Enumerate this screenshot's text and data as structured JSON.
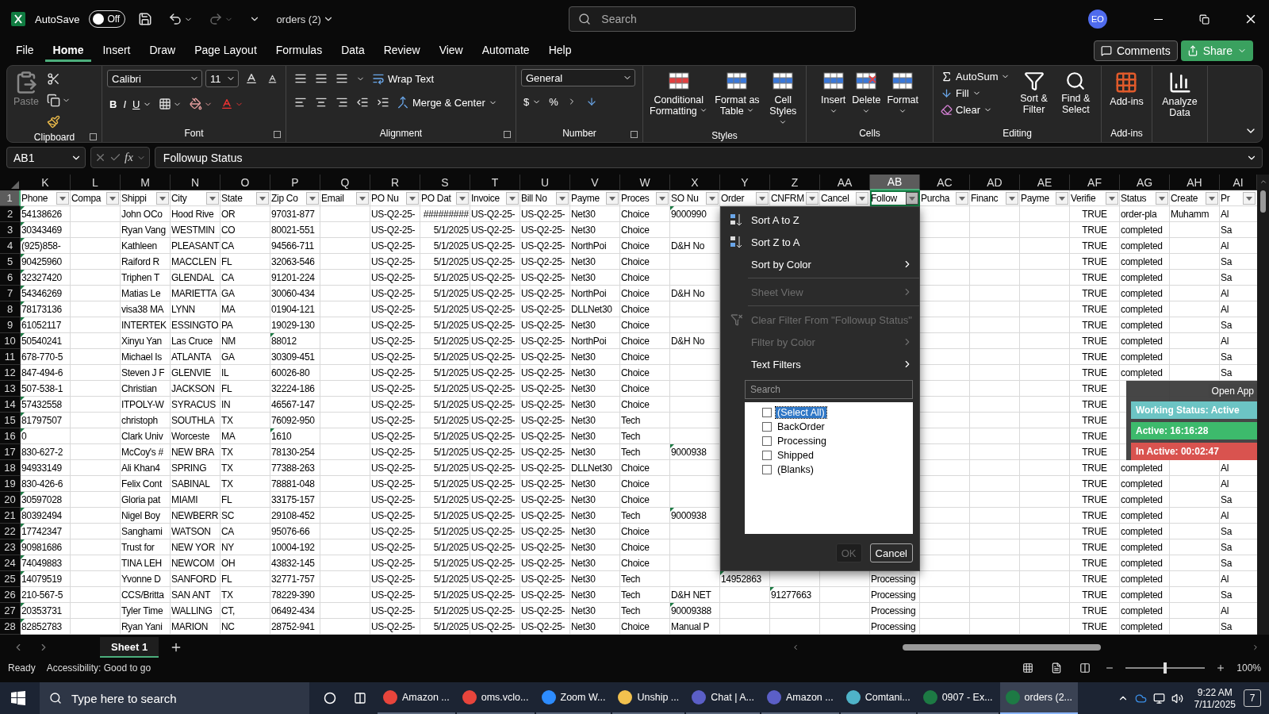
{
  "title_bar": {
    "autosave_label": "AutoSave",
    "autosave": {
      "on": false,
      "label": "Off"
    },
    "file_name": "orders (2)",
    "search_placeholder": "Search",
    "avatar": "EO"
  },
  "menu_tabs": [
    {
      "label": "File",
      "selected": false
    },
    {
      "label": "Home",
      "selected": true
    },
    {
      "label": "Insert",
      "selected": false
    },
    {
      "label": "Draw",
      "selected": false
    },
    {
      "label": "Page Layout",
      "selected": false
    },
    {
      "label": "Formulas",
      "selected": false
    },
    {
      "label": "Data",
      "selected": false
    },
    {
      "label": "Review",
      "selected": false
    },
    {
      "label": "View",
      "selected": false
    },
    {
      "label": "Automate",
      "selected": false
    },
    {
      "label": "Help",
      "selected": false
    }
  ],
  "comments": "Comments",
  "share": "Share",
  "ribbon": {
    "clipboard": {
      "paste": "Paste",
      "label": "Clipboard"
    },
    "font": {
      "family": "Calibri",
      "size": "11",
      "bold": "B",
      "italic": "I",
      "underline": "U",
      "label": "Font"
    },
    "alignment": {
      "wrap": "Wrap Text",
      "merge": "Merge & Center",
      "label": "Alignment"
    },
    "number": {
      "format": "General",
      "currency": "$",
      "percent": "%",
      "label": "Number"
    },
    "styles": {
      "buttons": [
        "Conditional Formatting",
        "Format as Table",
        "Cell Styles"
      ],
      "label": "Styles"
    },
    "cells": {
      "buttons": [
        "Insert",
        "Delete",
        "Format"
      ],
      "label": "Cells"
    },
    "editing": {
      "autosum": "AutoSum",
      "fill": "Fill",
      "clear": "Clear",
      "sort": "Sort & Filter",
      "find": "Find & Select",
      "label": "Editing"
    },
    "addins": {
      "button": "Add-ins",
      "label": "Add-ins"
    },
    "analyze": {
      "button": "Analyze Data"
    }
  },
  "formula_bar": {
    "name_box": "AB1",
    "fx": "fx",
    "formula": "Followup Status"
  },
  "sheet": {
    "header_row": {
      "num": "1",
      "selected": true
    },
    "columns": [
      {
        "letter": "K",
        "header": "Phone",
        "selected": false,
        "filter_open": false,
        "kind": "text"
      },
      {
        "letter": "L",
        "header": "Compa",
        "selected": false,
        "filter_open": false,
        "kind": "text"
      },
      {
        "letter": "M",
        "header": "Shippi",
        "selected": false,
        "filter_open": false,
        "kind": "text"
      },
      {
        "letter": "N",
        "header": "City",
        "selected": false,
        "filter_open": false,
        "kind": "text"
      },
      {
        "letter": "O",
        "header": "State",
        "selected": false,
        "filter_open": false,
        "kind": "text"
      },
      {
        "letter": "P",
        "header": "Zip Co",
        "selected": false,
        "filter_open": false,
        "kind": "text"
      },
      {
        "letter": "Q",
        "header": "Email",
        "selected": false,
        "filter_open": false,
        "kind": "text"
      },
      {
        "letter": "R",
        "header": "PO Nu",
        "selected": false,
        "filter_open": false,
        "kind": "text"
      },
      {
        "letter": "S",
        "header": "PO Dat",
        "selected": false,
        "filter_open": false,
        "kind": "date"
      },
      {
        "letter": "T",
        "header": "Invoice",
        "selected": false,
        "filter_open": false,
        "kind": "text"
      },
      {
        "letter": "U",
        "header": "Bill No",
        "selected": false,
        "filter_open": false,
        "kind": "text"
      },
      {
        "letter": "V",
        "header": "Payme",
        "selected": false,
        "filter_open": false,
        "kind": "text"
      },
      {
        "letter": "W",
        "header": "Proces",
        "selected": false,
        "filter_open": false,
        "kind": "text"
      },
      {
        "letter": "X",
        "header": "SO Nu",
        "selected": false,
        "filter_open": false,
        "kind": "text"
      },
      {
        "letter": "Y",
        "header": "Order",
        "selected": false,
        "filter_open": false,
        "kind": "text"
      },
      {
        "letter": "Z",
        "header": "CNFRM",
        "selected": false,
        "filter_open": false,
        "kind": "text"
      },
      {
        "letter": "AA",
        "header": "Cancel",
        "selected": false,
        "filter_open": false,
        "kind": "text"
      },
      {
        "letter": "AB",
        "header": "Follow",
        "selected": true,
        "filter_open": true,
        "kind": "text"
      },
      {
        "letter": "AC",
        "header": "Purcha",
        "selected": false,
        "filter_open": false,
        "kind": "text"
      },
      {
        "letter": "AD",
        "header": "Financ",
        "selected": false,
        "filter_open": false,
        "kind": "text"
      },
      {
        "letter": "AE",
        "header": "Payme",
        "selected": false,
        "filter_open": false,
        "kind": "text"
      },
      {
        "letter": "AF",
        "header": "Verifie",
        "selected": false,
        "filter_open": false,
        "kind": "boolean"
      },
      {
        "letter": "AG",
        "header": "Status",
        "selected": false,
        "filter_open": false,
        "kind": "text"
      },
      {
        "letter": "AH",
        "header": "Create",
        "selected": false,
        "filter_open": false,
        "kind": "text"
      },
      {
        "letter": "AI",
        "header": "Pr",
        "selected": false,
        "filter_open": false,
        "kind": "text"
      }
    ],
    "rows": [
      {
        "num": "2",
        "cells": [
          {
            "text": "54138626",
            "flagged": true
          },
          null,
          "John OCo",
          "Hood Rive",
          "OR",
          "97031-877",
          null,
          "US-Q2-25-",
          "#########",
          "US-Q2-25-",
          "US-Q2-25-",
          "Net30",
          "Choice",
          {
            "text": "9000990",
            "flagged": true
          },
          null,
          null,
          null,
          null,
          null,
          null,
          null,
          "TRUE",
          "order-pla",
          "Muhamm",
          "Al"
        ]
      },
      {
        "num": "3",
        "cells": [
          {
            "text": "30343469",
            "flagged": true
          },
          null,
          "Ryan Vang",
          "WESTMIN",
          "CO",
          "80021-551",
          null,
          "US-Q2-25-",
          "5/1/2025",
          "US-Q2-25-",
          "US-Q2-25-",
          "Net30",
          "Choice",
          null,
          null,
          null,
          null,
          null,
          null,
          null,
          null,
          "TRUE",
          "completed",
          null,
          "Sa"
        ]
      },
      {
        "num": "4",
        "cells": [
          {
            "text": "(925)858-",
            "flagged": true
          },
          null,
          "Kathleen",
          "PLEASANT",
          "CA",
          "94566-711",
          null,
          "US-Q2-25-",
          "5/1/2025",
          "US-Q2-25-",
          "US-Q2-25-",
          "NorthPoi",
          "Choice",
          "D&H No",
          null,
          null,
          null,
          null,
          null,
          null,
          null,
          "TRUE",
          "completed",
          null,
          "Al"
        ]
      },
      {
        "num": "5",
        "cells": [
          {
            "text": "90425960",
            "flagged": true
          },
          null,
          "Raiford R",
          "MACCLEN",
          "FL",
          "32063-546",
          null,
          "US-Q2-25-",
          "5/1/2025",
          "US-Q2-25-",
          "US-Q2-25-",
          "Net30",
          "Choice",
          null,
          null,
          null,
          null,
          null,
          null,
          null,
          null,
          "TRUE",
          "completed",
          null,
          "Sa"
        ]
      },
      {
        "num": "6",
        "cells": [
          {
            "text": "32327420",
            "flagged": true
          },
          null,
          "Triphen T",
          "GLENDAL",
          "CA",
          "91201-224",
          null,
          "US-Q2-25-",
          "5/1/2025",
          "US-Q2-25-",
          "US-Q2-25-",
          "Net30",
          "Choice",
          null,
          null,
          null,
          null,
          null,
          null,
          null,
          null,
          "TRUE",
          "completed",
          null,
          "Sa"
        ]
      },
      {
        "num": "7",
        "cells": [
          {
            "text": "54346269",
            "flagged": true
          },
          null,
          "Matias Le",
          "MARIETTA",
          "GA",
          "30060-434",
          null,
          "US-Q2-25-",
          "5/1/2025",
          "US-Q2-25-",
          "US-Q2-25-",
          "NorthPoi",
          "Choice",
          "D&H No",
          null,
          null,
          null,
          null,
          null,
          null,
          null,
          "TRUE",
          "completed",
          null,
          "Al"
        ]
      },
      {
        "num": "8",
        "cells": [
          {
            "text": "78173136",
            "flagged": true
          },
          null,
          "visa38 MA",
          "LYNN",
          "MA",
          "01904-121",
          null,
          "US-Q2-25-",
          "5/1/2025",
          "US-Q2-25-",
          "US-Q2-25-",
          "DLLNet30",
          "Choice",
          null,
          null,
          null,
          null,
          null,
          null,
          null,
          null,
          "TRUE",
          "completed",
          null,
          "Al"
        ]
      },
      {
        "num": "9",
        "cells": [
          {
            "text": "61052117",
            "flagged": true
          },
          null,
          "INTERTEK",
          "ESSINGTO",
          "PA",
          "19029-130",
          null,
          "US-Q2-25-",
          "5/1/2025",
          "US-Q2-25-",
          "US-Q2-25-",
          "Net30",
          "Choice",
          null,
          null,
          null,
          null,
          null,
          null,
          null,
          null,
          "TRUE",
          "completed",
          null,
          "Sa"
        ]
      },
      {
        "num": "10",
        "cells": [
          {
            "text": "50540241",
            "flagged": true
          },
          null,
          "Xinyu Yan",
          "Las Cruce",
          "NM",
          {
            "text": "88012",
            "flagged": true
          },
          null,
          "US-Q2-25-",
          "5/1/2025",
          "US-Q2-25-",
          "US-Q2-25-",
          "NorthPoi",
          "Choice",
          "D&H No",
          null,
          null,
          null,
          null,
          null,
          null,
          null,
          "TRUE",
          "completed",
          null,
          "Al"
        ]
      },
      {
        "num": "11",
        "cells": [
          "678-770-5",
          null,
          "Michael Is",
          "ATLANTA",
          "GA",
          "30309-451",
          null,
          "US-Q2-25-",
          "5/1/2025",
          "US-Q2-25-",
          "US-Q2-25-",
          "Net30",
          "Choice",
          null,
          null,
          null,
          null,
          null,
          null,
          null,
          null,
          "TRUE",
          "completed",
          null,
          "Sa"
        ]
      },
      {
        "num": "12",
        "cells": [
          "847-494-6",
          null,
          "Steven J F",
          "GLENVIE",
          "IL",
          "60026-80",
          null,
          "US-Q2-25-",
          "5/1/2025",
          "US-Q2-25-",
          "US-Q2-25-",
          "Net30",
          "Choice",
          null,
          null,
          null,
          null,
          null,
          null,
          null,
          null,
          "TRUE",
          "completed",
          null,
          "Sa"
        ]
      },
      {
        "num": "13",
        "cells": [
          "507-538-1",
          null,
          "Christian",
          "JACKSON",
          "FL",
          "32224-186",
          null,
          "US-Q2-25-",
          "5/1/2025",
          "US-Q2-25-",
          "US-Q2-25-",
          "Net30",
          "Choice",
          null,
          null,
          null,
          null,
          null,
          null,
          null,
          null,
          "TRUE",
          null,
          null,
          null
        ]
      },
      {
        "num": "14",
        "cells": [
          {
            "text": "57432558",
            "flagged": true
          },
          null,
          "ITPOLY-W",
          "SYRACUS",
          "IN",
          "46567-147",
          null,
          "US-Q2-25-",
          "5/1/2025",
          "US-Q2-25-",
          "US-Q2-25-",
          "Net30",
          "Choice",
          null,
          null,
          null,
          null,
          null,
          null,
          null,
          null,
          "TRUE",
          null,
          null,
          null
        ]
      },
      {
        "num": "15",
        "cells": [
          {
            "text": "81797507",
            "flagged": true
          },
          null,
          "christoph",
          "SOUTHLA",
          "TX",
          "76092-950",
          null,
          "US-Q2-25-",
          "5/1/2025",
          "US-Q2-25-",
          "US-Q2-25-",
          "Net30",
          "Tech",
          null,
          null,
          null,
          null,
          null,
          null,
          null,
          null,
          "TRUE",
          null,
          null,
          null
        ]
      },
      {
        "num": "16",
        "cells": [
          {
            "text": "0",
            "flagged": true
          },
          null,
          "Clark Univ",
          "Worceste",
          "MA",
          {
            "text": "1610",
            "flagged": true
          },
          null,
          "US-Q2-25-",
          "5/1/2025",
          "US-Q2-25-",
          "US-Q2-25-",
          "Net30",
          "Tech",
          null,
          null,
          null,
          null,
          null,
          null,
          null,
          null,
          "TRUE",
          null,
          null,
          null
        ]
      },
      {
        "num": "17",
        "cells": [
          "830-627-2",
          null,
          "McCoy's #",
          "NEW BRA",
          "TX",
          "78130-254",
          null,
          "US-Q2-25-",
          "5/1/2025",
          "US-Q2-25-",
          "US-Q2-25-",
          "Net30",
          "Tech",
          {
            "text": "9000938",
            "flagged": true
          },
          null,
          null,
          null,
          null,
          null,
          null,
          null,
          "TRUE",
          null,
          null,
          null
        ]
      },
      {
        "num": "18",
        "cells": [
          "94933149",
          null,
          "Ali Khan4",
          "SPRING",
          "TX",
          "77388-263",
          null,
          "US-Q2-25-",
          "5/1/2025",
          "US-Q2-25-",
          "US-Q2-25-",
          "DLLNet30",
          "Choice",
          null,
          null,
          null,
          null,
          null,
          null,
          null,
          null,
          "TRUE",
          "completed",
          null,
          "Al"
        ]
      },
      {
        "num": "19",
        "cells": [
          "830-426-6",
          null,
          "Felix Cont",
          "SABINAL",
          "TX",
          "78881-048",
          null,
          "US-Q2-25-",
          "5/1/2025",
          "US-Q2-25-",
          "US-Q2-25-",
          "Net30",
          "Choice",
          null,
          null,
          null,
          null,
          null,
          null,
          null,
          null,
          "TRUE",
          "completed",
          null,
          "Al"
        ]
      },
      {
        "num": "20",
        "cells": [
          {
            "text": "30597028",
            "flagged": true
          },
          null,
          "Gloria pat",
          "MIAMI",
          "FL",
          "33175-157",
          null,
          "US-Q2-25-",
          "5/1/2025",
          "US-Q2-25-",
          "US-Q2-25-",
          "Net30",
          "Choice",
          null,
          null,
          null,
          null,
          null,
          null,
          null,
          null,
          "TRUE",
          "completed",
          null,
          "Sa"
        ]
      },
      {
        "num": "21",
        "cells": [
          {
            "text": "80392494",
            "flagged": true
          },
          null,
          "Nigel Boy",
          "NEWBERR",
          "SC",
          "29108-452",
          null,
          "US-Q2-25-",
          "5/1/2025",
          "US-Q2-25-",
          "US-Q2-25-",
          "Net30",
          "Tech",
          {
            "text": "9000938",
            "flagged": true
          },
          null,
          null,
          null,
          null,
          null,
          null,
          null,
          "TRUE",
          "completed",
          null,
          "Al"
        ]
      },
      {
        "num": "22",
        "cells": [
          {
            "text": "17742347",
            "flagged": true
          },
          null,
          "Sanghami",
          "WATSON",
          "CA",
          "95076-66",
          null,
          "US-Q2-25-",
          "5/1/2025",
          "US-Q2-25-",
          "US-Q2-25-",
          "Net30",
          "Choice",
          null,
          null,
          null,
          null,
          null,
          null,
          null,
          null,
          "TRUE",
          "completed",
          null,
          "Sa"
        ]
      },
      {
        "num": "23",
        "cells": [
          {
            "text": "90981686",
            "flagged": true
          },
          null,
          "Trust for",
          "NEW YOR",
          "NY",
          "10004-192",
          null,
          "US-Q2-25-",
          "5/1/2025",
          "US-Q2-25-",
          "US-Q2-25-",
          "Net30",
          "Choice",
          null,
          null,
          null,
          null,
          null,
          null,
          null,
          null,
          "TRUE",
          "completed",
          null,
          "Sa"
        ]
      },
      {
        "num": "24",
        "cells": [
          {
            "text": "74049883",
            "flagged": true
          },
          null,
          "TINA LEH",
          "NEWCOM",
          "OH",
          "43832-145",
          null,
          "US-Q2-25-",
          "5/1/2025",
          "US-Q2-25-",
          "US-Q2-25-",
          "Net30",
          "Choice",
          null,
          null,
          null,
          null,
          null,
          null,
          null,
          null,
          "TRUE",
          "completed",
          null,
          "Sa"
        ]
      },
      {
        "num": "25",
        "cells": [
          {
            "text": "14079519",
            "flagged": true
          },
          null,
          "Yvonne D",
          "SANFORD",
          "FL",
          "32771-757",
          null,
          "US-Q2-25-",
          "5/1/2025",
          "US-Q2-25-",
          "US-Q2-25-",
          "Net30",
          "Tech",
          null,
          {
            "text": "14952863",
            "flagged": true
          },
          null,
          null,
          "Processing",
          null,
          null,
          null,
          "TRUE",
          "completed",
          null,
          "Al"
        ]
      },
      {
        "num": "26",
        "cells": [
          "210-567-5",
          null,
          "CCS/Britta",
          "SAN ANT",
          "TX",
          "78229-390",
          null,
          "US-Q2-25-",
          "5/1/2025",
          "US-Q2-25-",
          "US-Q2-25-",
          "Net30",
          "Tech",
          "D&H NET",
          null,
          {
            "text": "91277663",
            "flagged": true
          },
          null,
          "Processing",
          null,
          null,
          null,
          "TRUE",
          "completed",
          null,
          "Sa"
        ]
      },
      {
        "num": "27",
        "cells": [
          {
            "text": "20353731",
            "flagged": true
          },
          null,
          "Tyler Time",
          "WALLING",
          "CT,",
          "06492-434",
          null,
          "US-Q2-25-",
          "5/1/2025",
          "US-Q2-25-",
          "US-Q2-25-",
          "Net30",
          "Tech",
          {
            "text": "90009388",
            "flagged": true
          },
          null,
          null,
          null,
          "Processing",
          null,
          null,
          null,
          "TRUE",
          "completed",
          null,
          "Al"
        ]
      },
      {
        "num": "28",
        "cells": [
          {
            "text": "82852783",
            "flagged": true
          },
          null,
          "Ryan Yani",
          "MARION",
          "NC",
          "28752-941",
          null,
          "US-Q2-25-",
          "5/1/2025",
          "US-Q2-25-",
          "US-Q2-25-",
          "Net30",
          "Choice",
          "Manual P",
          null,
          null,
          null,
          "Processing",
          null,
          null,
          null,
          "TRUE",
          "completed",
          null,
          "Sa"
        ]
      }
    ]
  },
  "filter_menu": {
    "items": [
      {
        "kind": "sort_asc",
        "label": "Sort A to Z",
        "disabled": false,
        "submenu": false
      },
      {
        "kind": "sort_desc",
        "label": "Sort Z to A",
        "disabled": false,
        "submenu": false
      },
      {
        "kind": "plain",
        "label": "Sort by Color",
        "disabled": false,
        "submenu": true
      },
      {
        "kind": "separator"
      },
      {
        "kind": "plain",
        "label": "Sheet View",
        "disabled": true,
        "submenu": true
      },
      {
        "kind": "separator"
      },
      {
        "kind": "clear_filter",
        "label": "Clear Filter From \"Followup Status\"",
        "disabled": true,
        "submenu": false
      },
      {
        "kind": "plain",
        "label": "Filter by Color",
        "disabled": true,
        "submenu": true
      },
      {
        "kind": "plain",
        "label": "Text Filters",
        "disabled": false,
        "submenu": true
      }
    ],
    "search_placeholder": "Search",
    "values": [
      {
        "label": "(Select All)",
        "checked": false,
        "selected": true
      },
      {
        "label": "BackOrder",
        "checked": false,
        "selected": false
      },
      {
        "label": "Processing",
        "checked": false,
        "selected": false
      },
      {
        "label": "Shipped",
        "checked": false,
        "selected": false
      },
      {
        "label": "(Blanks)",
        "checked": false,
        "selected": false
      }
    ],
    "ok": {
      "label": "OK",
      "disabled": true
    },
    "cancel": {
      "label": "Cancel",
      "disabled": false
    }
  },
  "timer_widget": {
    "open_app": "Open App",
    "bars": [
      {
        "text": "Working Status: Active",
        "color": "#6cc4c4"
      },
      {
        "text": "Active: 16:16:28",
        "color": "#3dba6c"
      },
      {
        "text": "In Active: 00:02:47",
        "color": "#d9534f"
      }
    ]
  },
  "sheet_tabs": [
    {
      "label": "Sheet 1",
      "selected": true
    }
  ],
  "status_bar": {
    "ready": "Ready",
    "accessibility": "Accessibility: Good to go",
    "zoom": {
      "level": 0.5,
      "label": "100%"
    }
  },
  "taskbar": {
    "search_placeholder": "Type here to search",
    "apps": [
      {
        "label": "Amazon ...",
        "color": "#e8453c",
        "selected": false
      },
      {
        "label": "oms.vclo...",
        "color": "#e8453c",
        "selected": false
      },
      {
        "label": "Zoom W...",
        "color": "#2d8cff",
        "selected": false
      },
      {
        "label": "Unship ...",
        "color": "#f2c14e",
        "selected": false
      },
      {
        "label": "Chat | A...",
        "color": "#5b5fc7",
        "selected": false
      },
      {
        "label": "Amazon ...",
        "color": "#5b5fc7",
        "selected": false
      },
      {
        "label": "Comtani...",
        "color": "#4fb3c8",
        "selected": false
      },
      {
        "label": "0907 - Ex...",
        "color": "#1d7a44",
        "selected": false
      },
      {
        "label": "orders (2...",
        "color": "#1d7a44",
        "selected": true
      }
    ],
    "time": "9:22 AM",
    "date": "7/11/2025",
    "notifications": "7"
  }
}
